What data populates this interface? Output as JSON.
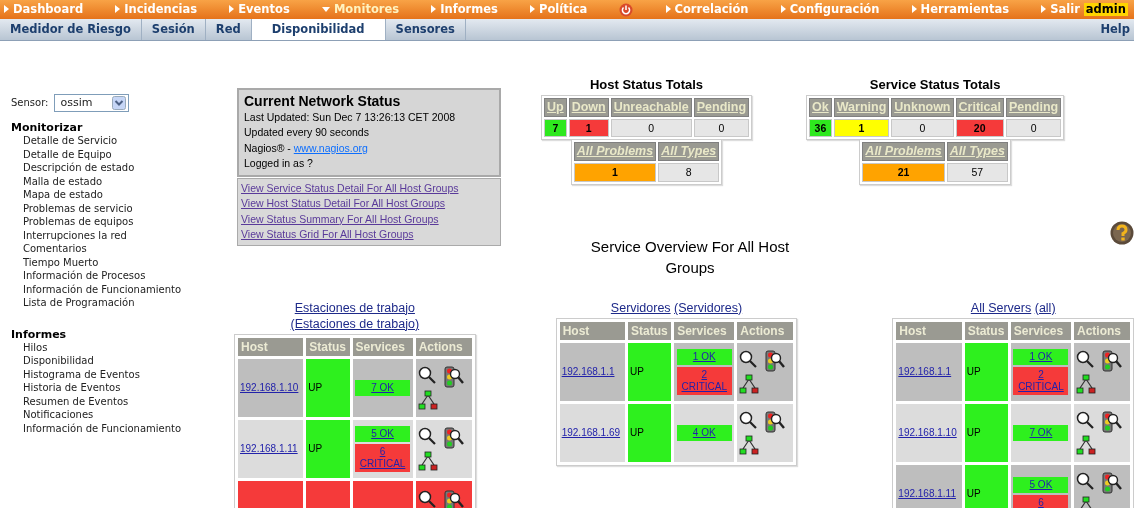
{
  "top_menu": [
    {
      "label": "Dashboard",
      "selected": false
    },
    {
      "label": "Incidencias",
      "selected": false
    },
    {
      "label": "Eventos",
      "selected": false
    },
    {
      "label": "Monitores",
      "selected": true
    },
    {
      "label": "Informes",
      "selected": false
    },
    {
      "label": "Política",
      "selected": false,
      "power_icon": true
    },
    {
      "label": "Correlación",
      "selected": false
    },
    {
      "label": "Configuración",
      "selected": false
    },
    {
      "label": "Herramientas",
      "selected": false
    },
    {
      "label": "Salir",
      "selected": false,
      "user": "admin"
    }
  ],
  "sub_tabs": [
    {
      "label": "Medidor de Riesgo",
      "selected": false
    },
    {
      "label": "Sesión",
      "selected": false
    },
    {
      "label": "Red",
      "selected": false
    },
    {
      "label": "Disponibilidad",
      "selected": true
    },
    {
      "label": "Sensores",
      "selected": false
    }
  ],
  "help_link": "Help",
  "sensor": {
    "label": "Sensor:",
    "value": "ossim"
  },
  "sidebar": [
    {
      "title": "Monitorizar",
      "items": [
        "Detalle de Servicio",
        "Detalle de Equipo",
        "Descripción de estado",
        "Malla de estado",
        "Mapa de estado",
        "Problemas de servicio",
        "Problemas de equipos",
        "Interrupciones la red",
        "Comentarios",
        "Tiempo Muerto",
        "Información de Procesos",
        "Información de Funcionamiento",
        "Lista de Programación"
      ]
    },
    {
      "title": "Informes",
      "items": [
        "Hilos",
        "Disponibilidad",
        "Histograma de Eventos",
        "Historia de Eventos",
        "Resumen de Eventos",
        "Notificaciones",
        "Información de Funcionamiento"
      ]
    }
  ],
  "network_status": {
    "title": "Current Network Status",
    "lines": [
      "Last Updated: Sun Dec 7 13:26:13 CET 2008",
      "Updated every 90 seconds"
    ],
    "credit": "Nagios® -",
    "credit_link": "www.nagios.org",
    "login": "Logged in as ?",
    "links": [
      "View Service Status Detail For All Host Groups",
      "View Host Status Detail For All Host Groups",
      "View Status Summary For All Host Groups",
      "View Status Grid For All Host Groups"
    ]
  },
  "totals": [
    {
      "title": "Host Status Totals",
      "cells": [
        {
          "label": "Up",
          "value": "7",
          "color": "#2ee81e"
        },
        {
          "label": "Down",
          "value": "1",
          "color": "#f53a3a"
        },
        {
          "label": "Unreachable",
          "value": "0",
          "color": "#e6e6e6"
        },
        {
          "label": "Pending",
          "value": "0",
          "color": "#e6e6e6"
        }
      ],
      "summary": [
        {
          "label": "All Problems",
          "value": "1",
          "color": "#ffa300"
        },
        {
          "label": "All Types",
          "value": "8",
          "color": "#e6e6e6"
        }
      ]
    },
    {
      "title": "Service Status Totals",
      "cells": [
        {
          "label": "Ok",
          "value": "36",
          "color": "#2ee81e"
        },
        {
          "label": "Warning",
          "value": "1",
          "color": "#ffff00"
        },
        {
          "label": "Unknown",
          "value": "0",
          "color": "#e6e6e6"
        },
        {
          "label": "Critical",
          "value": "20",
          "color": "#f53a3a"
        },
        {
          "label": "Pending",
          "value": "0",
          "color": "#e6e6e6"
        }
      ],
      "summary": [
        {
          "label": "All Problems",
          "value": "21",
          "color": "#ffa300"
        },
        {
          "label": "All Types",
          "value": "57",
          "color": "#e6e6e6"
        }
      ]
    }
  ],
  "overview_title": "Service Overview For All Host Groups",
  "groups": [
    {
      "name": "Estaciones de trabajo",
      "alias": "(Estaciones de trabajo)",
      "columns": [
        "Host",
        "Status",
        "Services",
        "Actions"
      ],
      "rows": [
        {
          "host": "192.168.1.10",
          "status": "UP",
          "color": "#2ef01e",
          "services": [
            {
              "text": "7 OK",
              "color": "#2ef01e"
            }
          ]
        },
        {
          "host": "192.168.1.11",
          "status": "UP",
          "color": "#2ef01e",
          "services": [
            {
              "text": "5 OK",
              "color": "#2ef01e"
            },
            {
              "text": "6 CRITICAL",
              "color": "#f53a3a"
            }
          ]
        },
        {
          "color": "#f53a3a"
        }
      ]
    },
    {
      "name": "Servidores",
      "alias": "(Servidores)",
      "columns": [
        "Host",
        "Status",
        "Services",
        "Actions"
      ],
      "rows": [
        {
          "host": "192.168.1.1",
          "status": "UP",
          "color": "#2ef01e",
          "services": [
            {
              "text": "1 OK",
              "color": "#2ef01e"
            },
            {
              "text": "2 CRITICAL",
              "color": "#f53a3a"
            }
          ]
        },
        {
          "host": "192.168.1.69",
          "status": "UP",
          "color": "#2ef01e",
          "services": [
            {
              "text": "4 OK",
              "color": "#2ef01e"
            }
          ]
        }
      ]
    },
    {
      "name": "All Servers",
      "alias": "(all)",
      "columns": [
        "Host",
        "Status",
        "Services",
        "Actions"
      ],
      "rows": [
        {
          "host": "192.168.1.1",
          "status": "UP",
          "color": "#2ef01e",
          "services": [
            {
              "text": "1 OK",
              "color": "#2ef01e"
            },
            {
              "text": "2 CRITICAL",
              "color": "#f53a3a"
            }
          ]
        },
        {
          "host": "192.168.1.10",
          "status": "UP",
          "color": "#2ef01e",
          "services": [
            {
              "text": "7 OK",
              "color": "#2ef01e"
            }
          ]
        },
        {
          "host": "192.168.1.11",
          "status": "UP",
          "color": "#2ef01e",
          "services": [
            {
              "text": "5 OK",
              "color": "#2ef01e"
            },
            {
              "text": "6",
              "color": "#f53a3a"
            }
          ]
        }
      ]
    }
  ]
}
